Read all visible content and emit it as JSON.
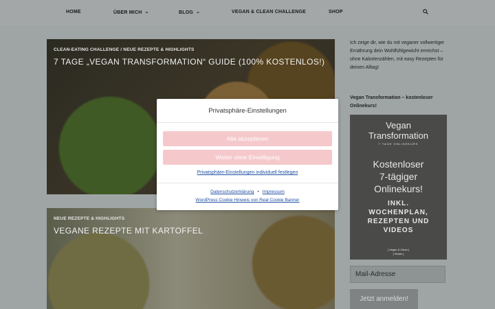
{
  "nav": {
    "items": [
      {
        "label": "HOME",
        "dropdown": false
      },
      {
        "label": "ÜBER MICH",
        "dropdown": true
      },
      {
        "label": "BLOG",
        "dropdown": true
      },
      {
        "label": "VEGAN & CLEAN CHALLENGE",
        "dropdown": false
      },
      {
        "label": "SHOP",
        "dropdown": false
      }
    ],
    "search_icon": "search-icon"
  },
  "posts": [
    {
      "category": "CLEAN-EATING CHALLENGE / NEUE REZEPTE & HIGHLIGHTS",
      "title": "7 TAGE „VEGAN TRANSFORMATION“ GUIDE (100% KOSTENLOS!)"
    },
    {
      "category": "NEUE REZEPTE & HIGHLIGHTS",
      "title": "VEGANE REZEPTE MIT KARTOFFEL"
    }
  ],
  "sidebar": {
    "intro": "Ich zeige dir, wie du mit veganer vollwertiger Ernährung dein Wohlfühlgewicht erreichst – ohne Kalorienzählen, mit easy Rezepten für deinen Alltag!",
    "heading": "Vegan Transformation – kostenloser Onlinekurs!",
    "promo": {
      "title1": "Vegan",
      "title2": "Transformation",
      "sub": "7 TAGE ONLINEKURS",
      "kurs1": "Kostenloser",
      "kurs2": "7-tägiger",
      "kurs3": "Onlinekurs!",
      "inkl1": "INKL.",
      "inkl2": "WOCHENPLAN,",
      "inkl3": "REZEPTEN UND",
      "inkl4": "VIDEOS",
      "brand1": "[ Vegan & Clean ]",
      "brand2": "[ Studio ]"
    },
    "mail_placeholder": "Mail-Adresse",
    "signup_label": "Jetzt anmelden!"
  },
  "modal": {
    "title": "Privatsphäre-Einstellungen",
    "accept_all": "Alle akzeptieren",
    "continue_without": "Weiter ohne Einwilligung",
    "individual": "Privatsphäre-Einstellungen individuell festlegen",
    "privacy": "Datenschutzerklärung",
    "separator": "•",
    "imprint": "Impressum",
    "credit": "WordPress Cookie Hinweis von Real Cookie Banner"
  },
  "colors": {
    "button_pink": "#f5c9cc",
    "link_blue": "#1f4fa1",
    "overlay_grey": "#9fa5a5"
  }
}
